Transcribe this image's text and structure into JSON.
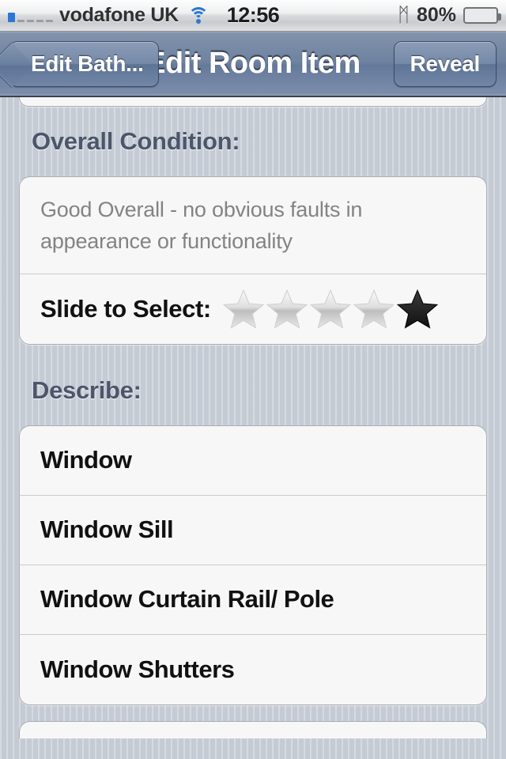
{
  "status_bar": {
    "carrier": "vodafone UK",
    "time": "12:56",
    "battery_percent": "80%",
    "battery_level": 80,
    "wifi_icon": "wifi-icon",
    "bluetooth_icon": "bluetooth-icon",
    "bluetooth_glyph": "ᛗ",
    "signal_icon": "signal-dots-icon",
    "signal_bars": 1,
    "signal_total": 5
  },
  "nav_bar": {
    "back_label": "Edit Bath...",
    "title": "Edit Room Item",
    "right_label": "Reveal"
  },
  "sections": {
    "overall_condition": {
      "header": "Overall Condition:",
      "description": "Good Overall - no obvious faults in appearance or functionality",
      "rating_label": "Slide to Select:",
      "rating_value": 1,
      "rating_max": 5,
      "stars_selected_index": 4
    },
    "describe": {
      "header": "Describe:",
      "items": [
        {
          "label": "Window"
        },
        {
          "label": "Window Sill"
        },
        {
          "label": "Window Curtain Rail/ Pole"
        },
        {
          "label": "Window Shutters"
        }
      ]
    }
  },
  "colors": {
    "background": "#c5cbd4",
    "navbar": "#6e82a0",
    "section_header_text": "#4c566b",
    "card_background": "#f7f7f7",
    "description_text": "#838383",
    "row_text": "#111111",
    "battery_green": "#62c324",
    "accent_blue": "#2b77d6"
  }
}
